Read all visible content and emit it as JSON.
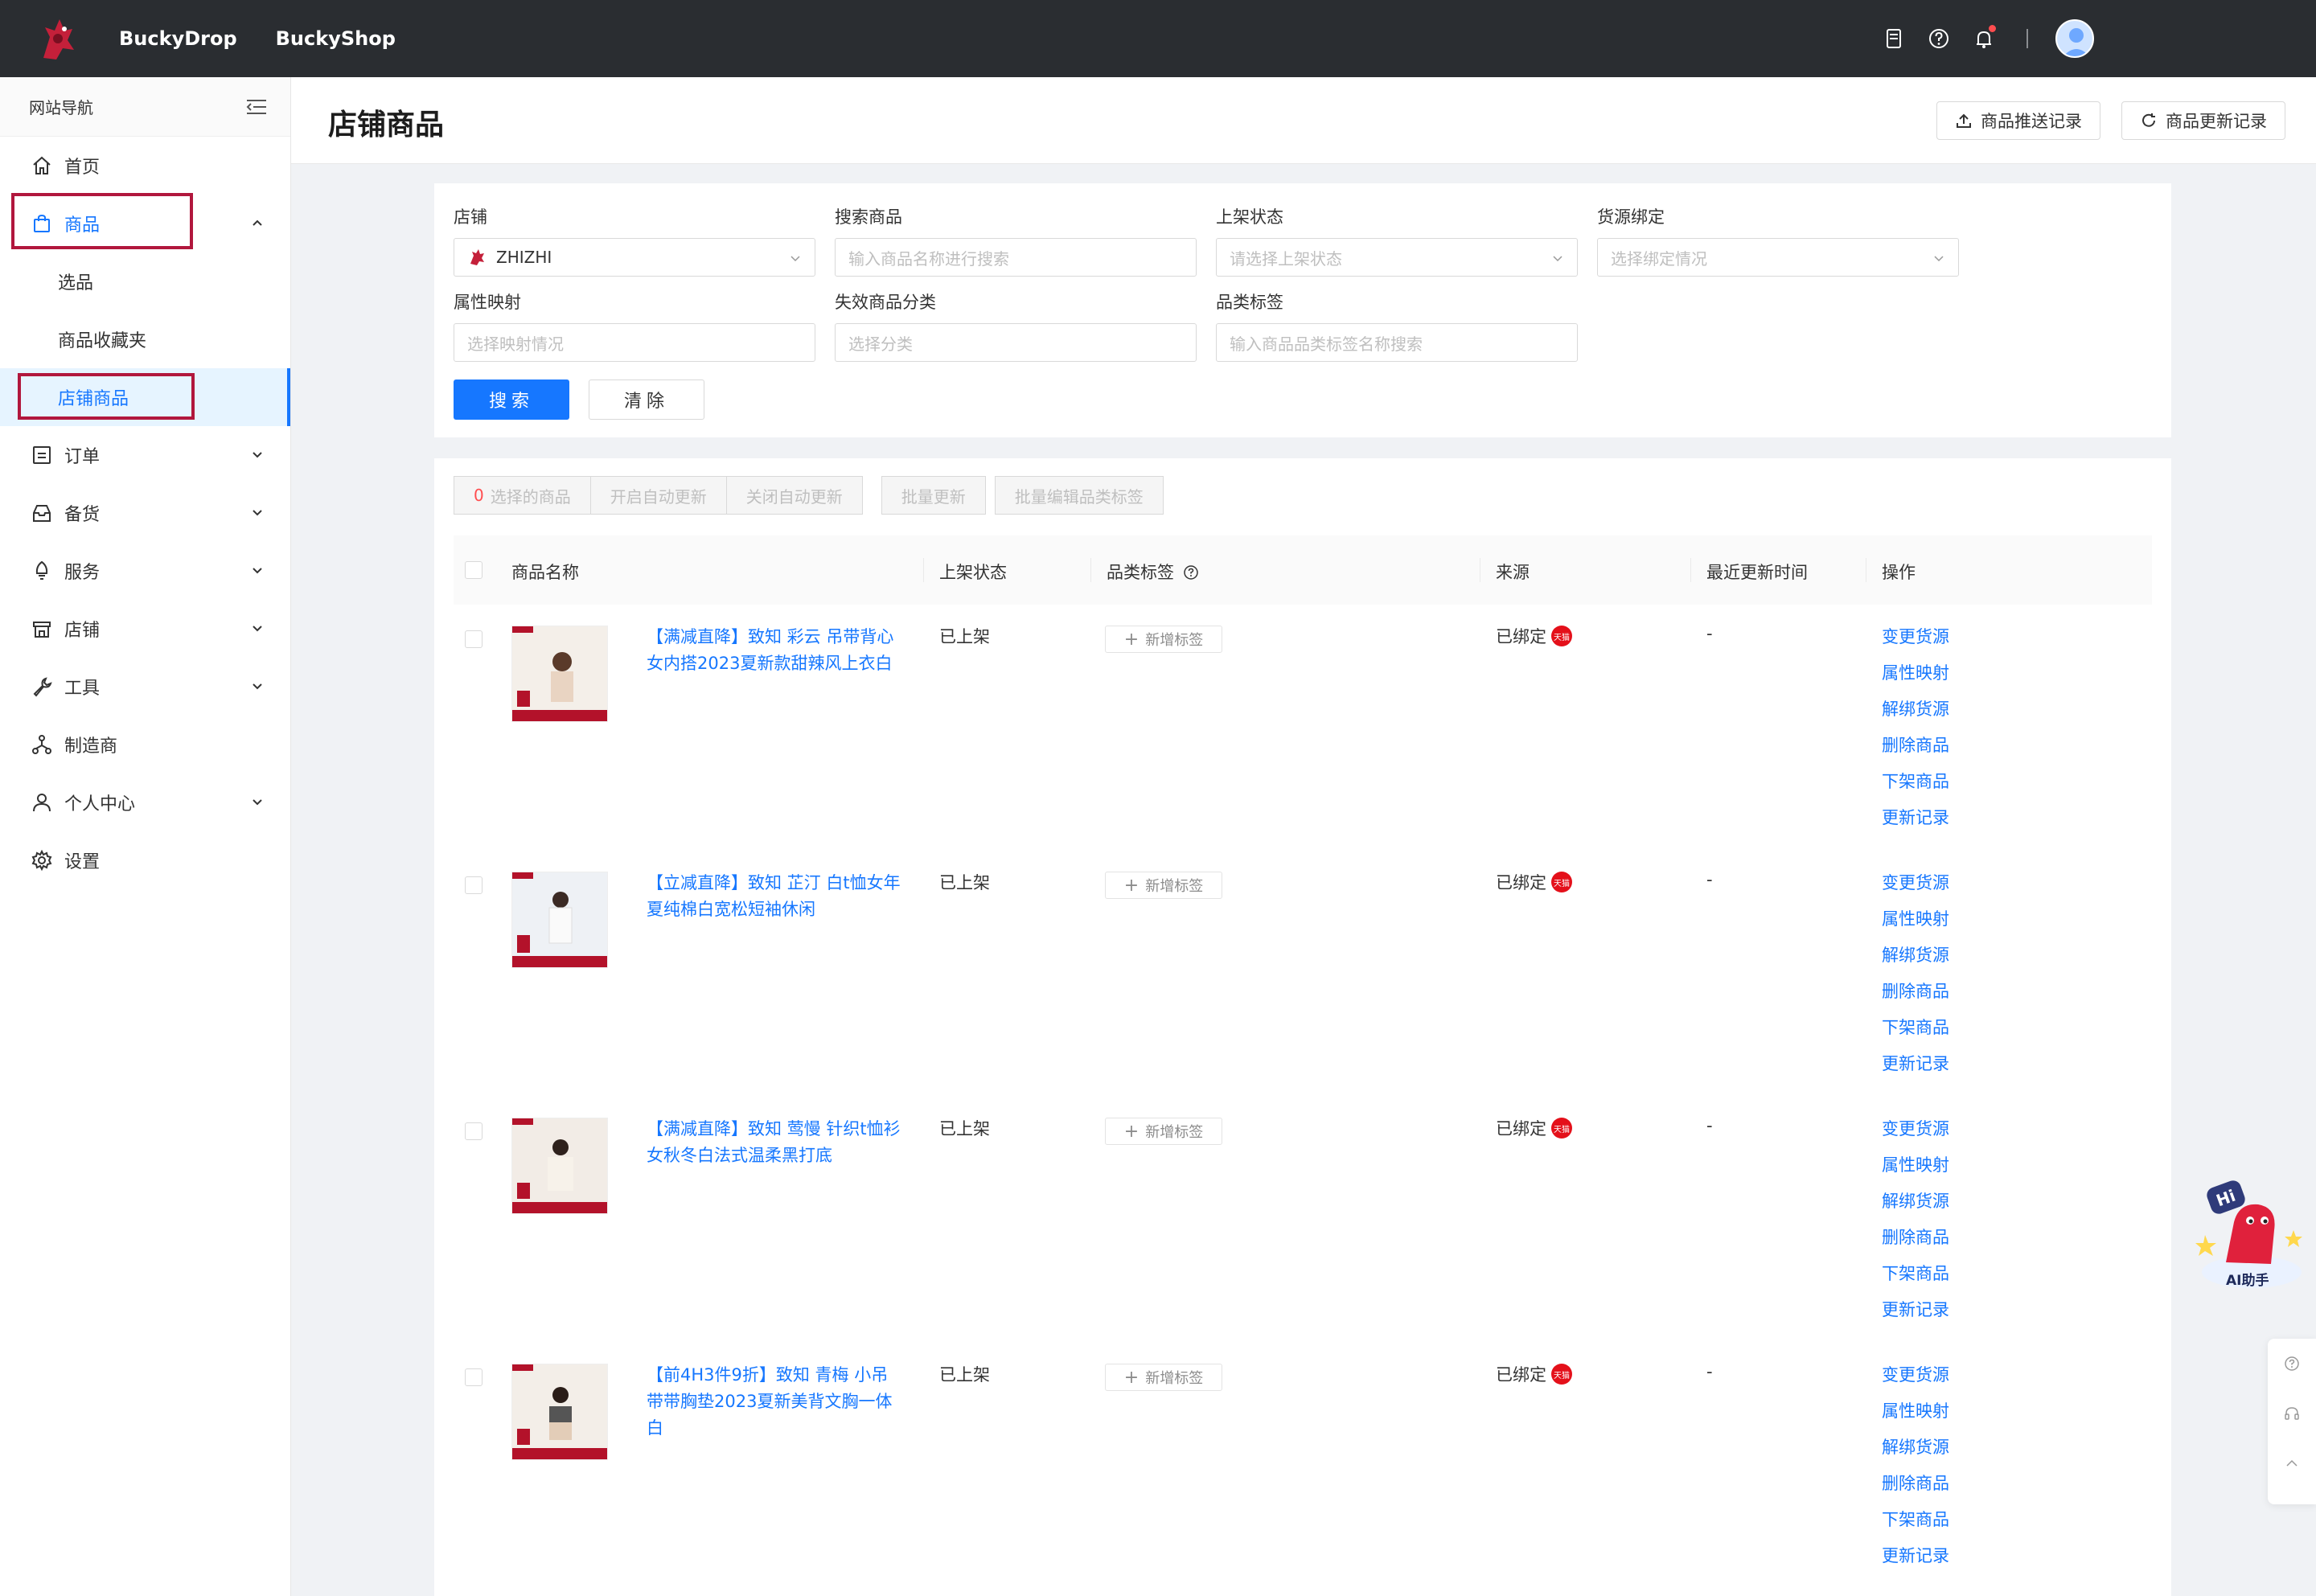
{
  "topbar": {
    "brand1": "BuckyDrop",
    "brand2": "BuckyShop",
    "icons": [
      "doc-icon",
      "help-icon",
      "bell-icon"
    ],
    "accent": "#1677ff"
  },
  "sidebar": {
    "header": "网站导航",
    "items": [
      {
        "label": "首页",
        "icon": "home-icon"
      },
      {
        "label": "商品",
        "icon": "bag-icon"
      },
      {
        "label": "订单",
        "icon": "order-icon"
      },
      {
        "label": "备货",
        "icon": "inbox-icon"
      },
      {
        "label": "服务",
        "icon": "service-icon"
      },
      {
        "label": "店铺",
        "icon": "shop-icon"
      },
      {
        "label": "工具",
        "icon": "wrench-icon"
      },
      {
        "label": "制造商",
        "icon": "network-icon"
      },
      {
        "label": "个人中心",
        "icon": "user-icon"
      },
      {
        "label": "设置",
        "icon": "gear-icon"
      }
    ],
    "sub_items": [
      "选品",
      "商品收藏夹",
      "店铺商品"
    ]
  },
  "page": {
    "title": "店铺商品",
    "push_log_btn": "商品推送记录",
    "update_log_btn": "商品更新记录"
  },
  "filters": {
    "shop_label": "店铺",
    "shop_value": "ZHIZHI",
    "search_label": "搜索商品",
    "search_placeholder": "输入商品名称进行搜索",
    "status_label": "上架状态",
    "status_placeholder": "请选择上架状态",
    "binding_label": "货源绑定",
    "binding_placeholder": "选择绑定情况",
    "mapping_label": "属性映射",
    "mapping_placeholder": "选择映射情况",
    "invalid_label": "失效商品分类",
    "invalid_placeholder": "选择分类",
    "tag_label": "品类标签",
    "tag_placeholder": "输入商品品类标签名称搜索",
    "search_btn": "搜索",
    "clear_btn": "清除"
  },
  "batch": {
    "selected_count": "0",
    "selected_text": "选择的商品",
    "auto_on": "开启自动更新",
    "auto_off": "关闭自动更新",
    "batch_update": "批量更新",
    "batch_tag": "批量编辑品类标签"
  },
  "table": {
    "columns": [
      "商品名称",
      "上架状态",
      "品类标签",
      "来源",
      "最近更新时间",
      "操作"
    ],
    "add_tag": "新增标签",
    "tmall_badge": "天猫",
    "ops": [
      "变更货源",
      "属性映射",
      "解绑货源",
      "删除商品",
      "下架商品",
      "更新记录"
    ],
    "rows": [
      {
        "name": "【满减直降】致知 彩云 吊带背心女内搭2023夏新款甜辣风上衣白",
        "status": "已上架",
        "source": "已绑定",
        "time": "-"
      },
      {
        "name": "【立减直降】致知 芷汀 白t恤女年夏纯棉白宽松短袖休闲",
        "status": "已上架",
        "source": "已绑定",
        "time": "-"
      },
      {
        "name": "【满减直降】致知 莺慢 针织t恤衫女秋冬白法式温柔黑打底",
        "status": "已上架",
        "source": "已绑定",
        "time": "-"
      },
      {
        "name": "【前4H3件9折】致知 青梅 小吊带带胸垫2023夏新美背文胸一体白",
        "status": "已上架",
        "source": "已绑定",
        "time": "-"
      }
    ]
  },
  "float": {
    "ai_label": "AI助手",
    "hi": "Hi"
  }
}
